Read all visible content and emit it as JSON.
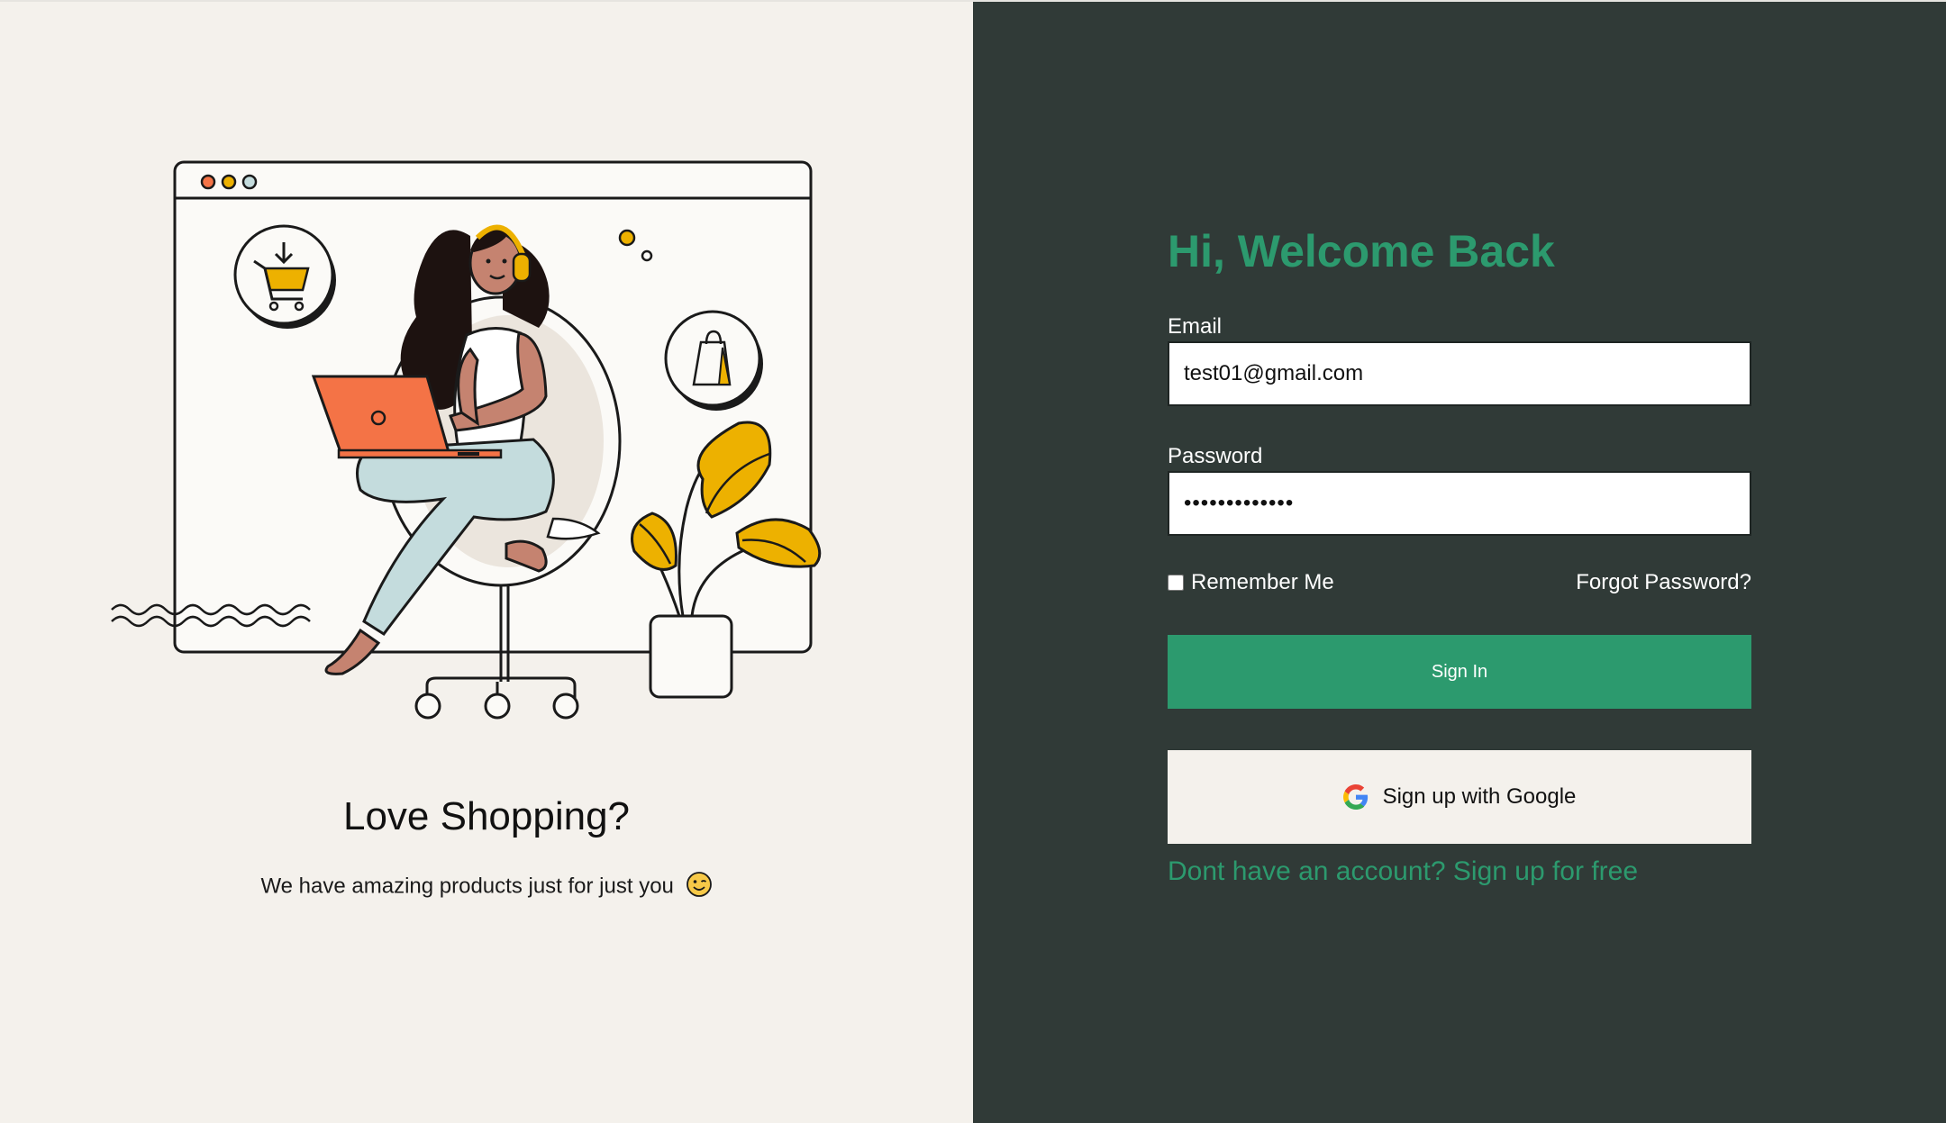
{
  "promo": {
    "title": "Love Shopping?",
    "subtitle": "We have amazing products just for just you"
  },
  "form": {
    "heading": "Hi, Welcome Back",
    "email_label": "Email",
    "email_value": "test01@gmail.com",
    "password_label": "Password",
    "password_value": "•••••••••••••",
    "remember_label": "Remember Me",
    "remember_checked": false,
    "forgot_label": "Forgot Password?",
    "signin_label": "Sign In",
    "google_label": "Sign up with Google",
    "signup_link": "Dont have an account? Sign up for free"
  },
  "colors": {
    "left_bg": "#f4f1ec",
    "right_bg": "#303a37",
    "accent_green": "#2c9a6e",
    "laptop_orange": "#f47346",
    "plant_yellow": "#edb100"
  },
  "icons": {
    "illustration": "woman-shopping-laptop-illustration",
    "cart": "shopping-cart-icon",
    "bag": "shopping-bag-icon",
    "google": "google-icon",
    "emoji": "wink-emoji-icon"
  }
}
